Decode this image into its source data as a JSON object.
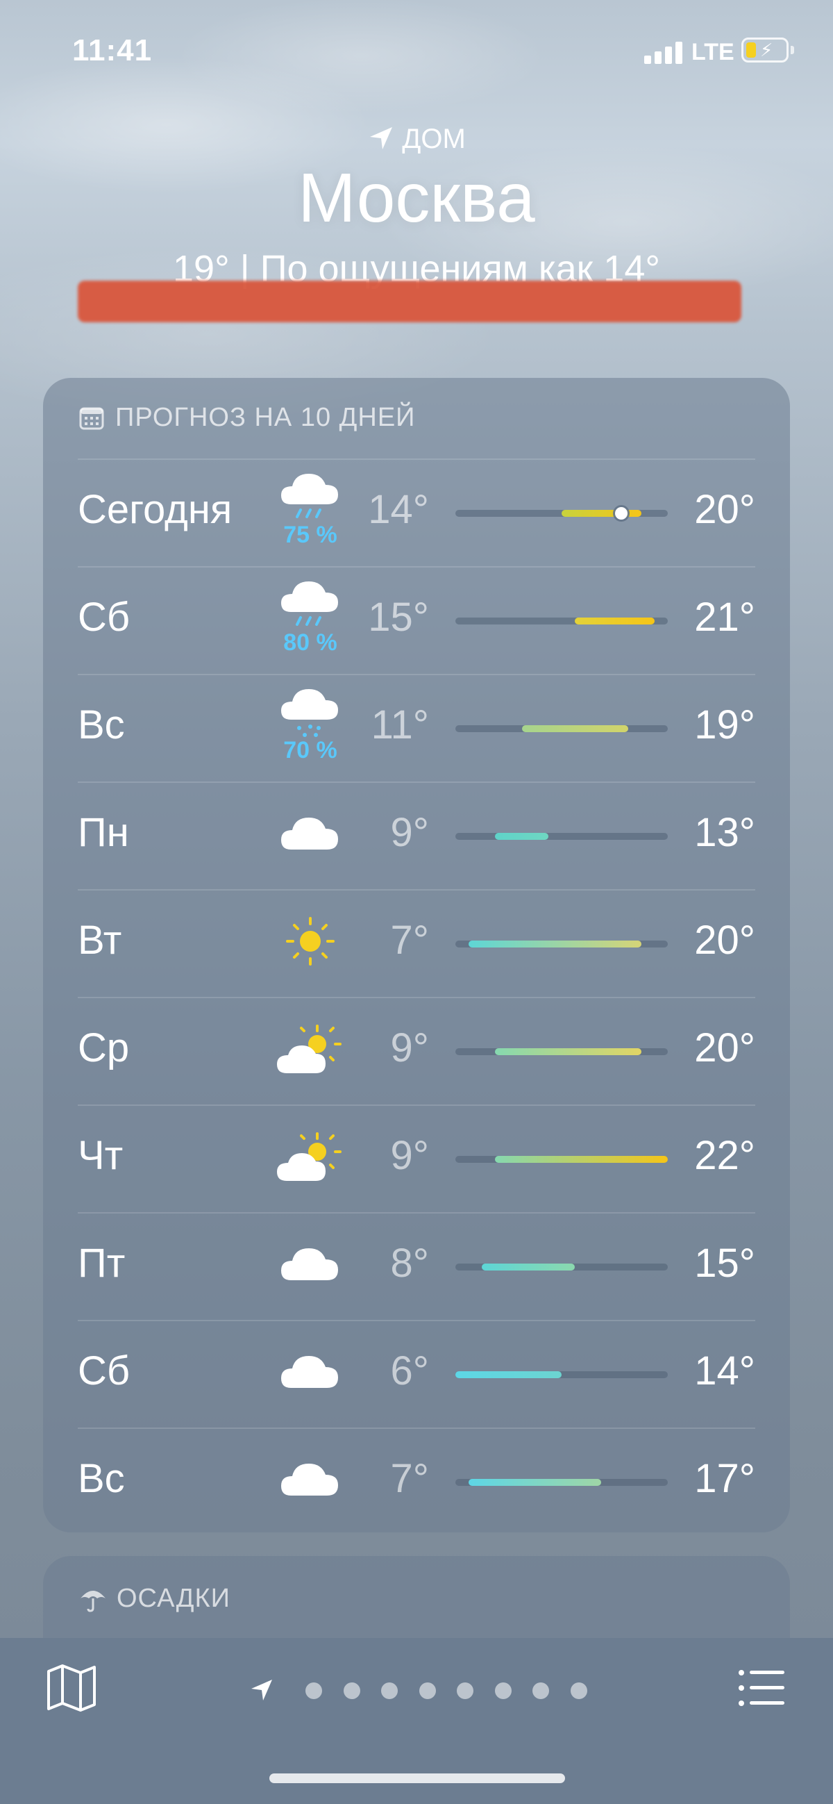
{
  "status_bar": {
    "time": "11:41",
    "network": "LTE"
  },
  "header": {
    "location_label": "ДОМ",
    "city": "Москва",
    "current": "19°  |  По ощущениям как 14°"
  },
  "forecast": {
    "title": "ПРОГНОЗ НА 10 ДНЕЙ",
    "range_low": 6,
    "range_high": 22,
    "days": [
      {
        "day": "Сегодня",
        "icon": "cloud-rain-icon",
        "precip": "75 %",
        "min": "14°",
        "max": "20°",
        "min_v": 14,
        "max_v": 20,
        "current_v": 18.5,
        "color_start": "#c8d23c",
        "color_end": "#f5c518"
      },
      {
        "day": "Сб",
        "icon": "cloud-rain-icon",
        "precip": "80 %",
        "min": "15°",
        "max": "21°",
        "min_v": 15,
        "max_v": 21,
        "color_start": "#e3d23a",
        "color_end": "#f5c518"
      },
      {
        "day": "Вс",
        "icon": "cloud-drizzle-icon",
        "precip": "70 %",
        "min": "11°",
        "max": "19°",
        "min_v": 11,
        "max_v": 19,
        "color_start": "#a6d48e",
        "color_end": "#d2d46a"
      },
      {
        "day": "Пн",
        "icon": "cloud-icon",
        "precip": "",
        "min": "9°",
        "max": "13°",
        "min_v": 9,
        "max_v": 13,
        "color_start": "#5fd3c9",
        "color_end": "#6fd6c2"
      },
      {
        "day": "Вт",
        "icon": "sun-icon",
        "precip": "",
        "min": "7°",
        "max": "20°",
        "min_v": 7,
        "max_v": 20,
        "color_start": "#5dd6d6",
        "color_end": "#d6d477"
      },
      {
        "day": "Ср",
        "icon": "sun-cloud-icon",
        "precip": "",
        "min": "9°",
        "max": "20°",
        "min_v": 9,
        "max_v": 20,
        "color_start": "#86d8b0",
        "color_end": "#e2d564"
      },
      {
        "day": "Чт",
        "icon": "sun-cloud-icon",
        "precip": "",
        "min": "9°",
        "max": "22°",
        "min_v": 9,
        "max_v": 22,
        "color_start": "#86d8b0",
        "color_end": "#f5c518"
      },
      {
        "day": "Пт",
        "icon": "cloud-icon",
        "precip": "",
        "min": "8°",
        "max": "15°",
        "min_v": 8,
        "max_v": 15,
        "color_start": "#5dd6d6",
        "color_end": "#8bd8ae"
      },
      {
        "day": "Сб",
        "icon": "cloud-icon",
        "precip": "",
        "min": "6°",
        "max": "14°",
        "min_v": 6,
        "max_v": 14,
        "color_start": "#5dd6e6",
        "color_end": "#6cd4d0"
      },
      {
        "day": "Вс",
        "icon": "cloud-icon",
        "precip": "",
        "min": "7°",
        "max": "17°",
        "min_v": 7,
        "max_v": 17,
        "color_start": "#5dd6e6",
        "color_end": "#9fd6a6"
      }
    ]
  },
  "precipitation_card": {
    "title": "ОСАДКИ"
  },
  "toolbar": {
    "page_count": 8
  },
  "colors": {
    "precip": "#5ac8fa",
    "sun": "#f5d020"
  }
}
